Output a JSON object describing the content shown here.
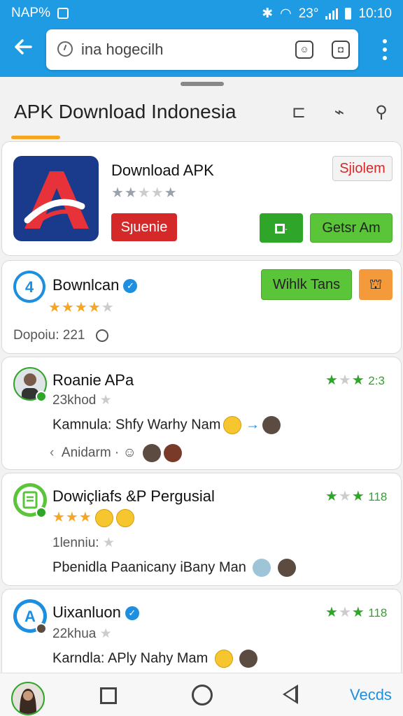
{
  "status_bar": {
    "left_text": "NAP%",
    "right_text": "23°",
    "time": "10:10"
  },
  "toolbar": {
    "url_placeholder": "ina hogecilh"
  },
  "page": {
    "title": "APK  Download Indonesia"
  },
  "featured": {
    "name": "Download APK",
    "rating": 2,
    "rating_max": 5,
    "tag_label": "Sjiolem",
    "primary_button": "Sȷuenie",
    "secondary_button": "Getsr Am",
    "icon_name": "apk-logo-icon"
  },
  "app_card": {
    "name": "Bownlcan",
    "verified": true,
    "rating": 4,
    "rating_max": 5,
    "button_label": "Wihlk Tans",
    "downloads": "Dopoiu: 221"
  },
  "reviews": [
    {
      "title": "Roanie APa",
      "rating": 2,
      "rating_count": "2:3",
      "subtitle": "23khod",
      "text": "Kamnula: Shfy Warhy Nam",
      "footer_label": "Anidarm"
    },
    {
      "title": "Dowiçliafs &P Pergusial",
      "rating": 2,
      "rating_count": "118",
      "inline_stars": 3,
      "subtitle": "1lenniu:",
      "text": "Pbenidla Paanicany iBany Man"
    },
    {
      "title": "Uixanluon",
      "verified": true,
      "rating": 2,
      "rating_count": "118",
      "subtitle": "22khua",
      "text": "Karndla: APly Nahy Mam"
    }
  ],
  "navbar": {
    "link_label": "Vecds"
  },
  "colors": {
    "toolbar": "#1e9be3",
    "accent_orange": "#f5a623",
    "red": "#d52828",
    "green": "#5bc53a",
    "dark_green": "#2fa52a",
    "blue": "#1e8fe0"
  }
}
